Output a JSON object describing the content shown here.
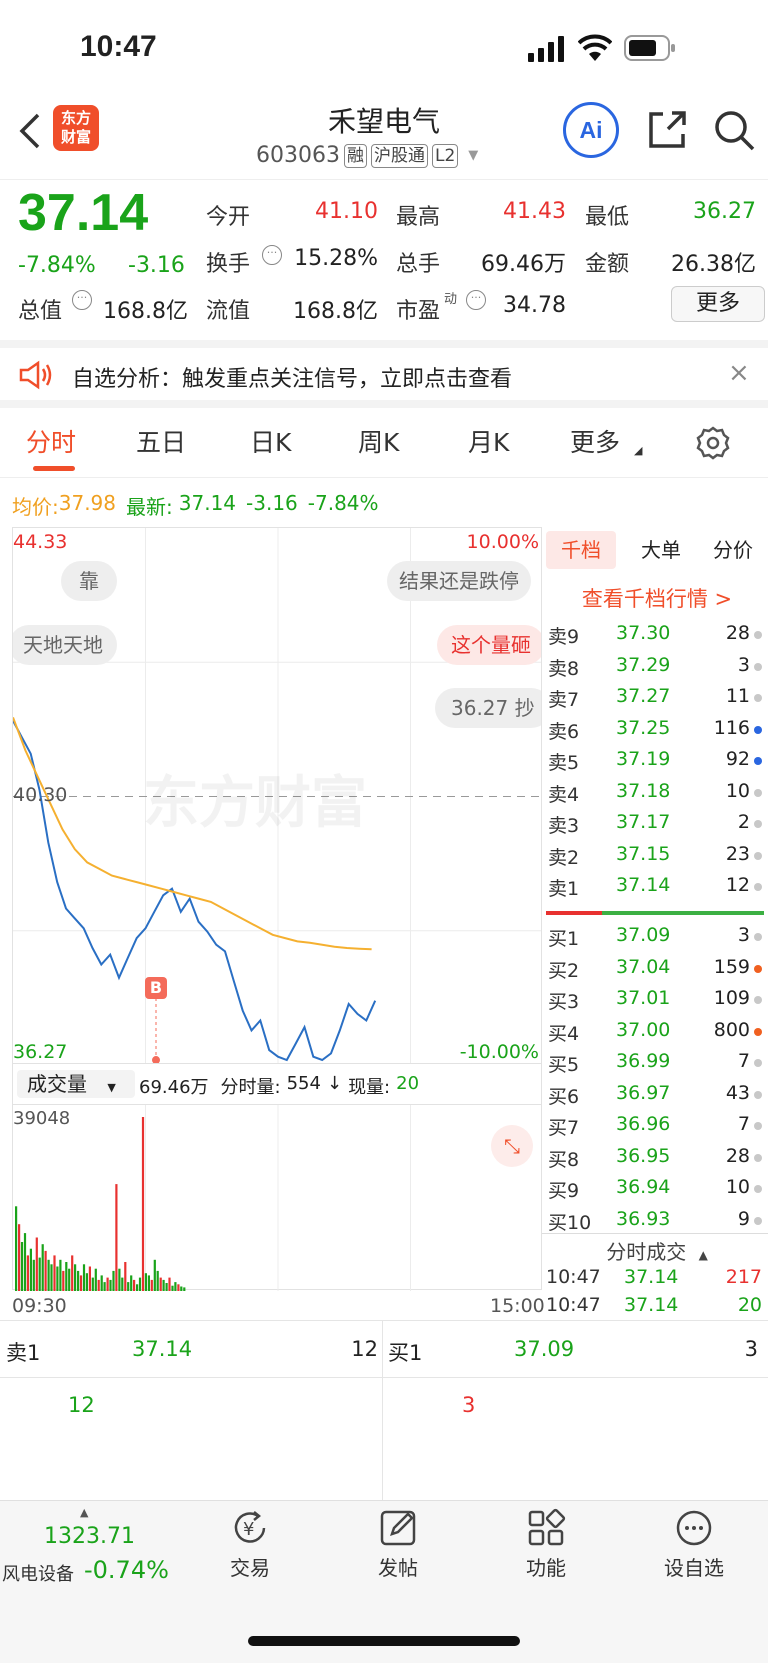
{
  "status_bar": {
    "time": "10:47"
  },
  "header": {
    "logo_line1": "东方",
    "logo_line2": "财富",
    "stock_name": "禾望电气",
    "stock_code": "603063",
    "tags": [
      "融",
      "沪股通",
      "L2"
    ]
  },
  "quote": {
    "price": "37.14",
    "change_pct": "-7.84%",
    "change": "-3.16",
    "fields": [
      {
        "label": "今开",
        "value": "41.10",
        "color": "red"
      },
      {
        "label": "最高",
        "value": "41.43",
        "color": "red"
      },
      {
        "label": "最低",
        "value": "36.27",
        "color": "green"
      },
      {
        "label": "换手",
        "value": "15.28%",
        "color": "dark"
      },
      {
        "label": "总手",
        "value": "69.46万",
        "color": "dark"
      },
      {
        "label": "金额",
        "value": "26.38亿",
        "color": "dark"
      },
      {
        "label": "总值",
        "value": "168.8亿",
        "color": "dark"
      },
      {
        "label": "流值",
        "value": "168.8亿",
        "color": "dark"
      },
      {
        "label": "市盈",
        "value": "34.78",
        "color": "dark"
      }
    ],
    "pe_superscript": "动",
    "more_button": "更多"
  },
  "notice": {
    "text": "自选分析：触发重点关注信号，立即点击查看"
  },
  "tabs": [
    "分时",
    "五日",
    "日K",
    "周K",
    "月K",
    "更多"
  ],
  "chart_header": {
    "avg_label": "均价:",
    "avg_value": "37.98",
    "latest_label": "最新:",
    "latest_value": "37.14",
    "change": "-3.16",
    "change_pct": "-7.84%"
  },
  "bubbles": [
    "靠",
    "天地天地",
    "结果还是跌停",
    "这个量砸",
    "36.27 抄"
  ],
  "watermark": "东方财富",
  "volume_header": {
    "selector": "成交量",
    "total": "69.46万",
    "minute_label": "分时量:",
    "minute_value": "554",
    "arrow": "↓",
    "now_label": "现量:",
    "now_value": "20"
  },
  "chart_data": [
    {
      "type": "line",
      "ylim": [
        36.27,
        44.33
      ],
      "y_tick_labels": [
        "44.33",
        "40.30",
        "36.27"
      ],
      "right_tick_labels": [
        "10.00%",
        "-10.00%"
      ],
      "x_tick_labels": [
        "09:30",
        "15:00"
      ],
      "prev_close": 40.3,
      "series": [
        {
          "values": [
            41.45,
            41.2,
            40.95,
            40.4,
            39.6,
            39.0,
            38.6,
            38.45,
            38.3,
            38.0,
            37.75,
            37.9,
            37.55,
            37.85,
            38.15,
            38.3,
            38.55,
            38.8,
            38.9,
            38.55,
            38.75,
            38.4,
            38.25,
            38.05,
            37.95,
            37.5,
            37.05,
            36.75,
            36.9,
            36.45,
            36.35,
            36.3,
            36.55,
            36.8,
            36.35,
            36.3,
            36.4,
            36.75,
            37.15,
            37.0,
            36.9,
            37.2
          ]
        },
        {
          "values": [
            41.5,
            41.0,
            40.6,
            40.2,
            39.8,
            39.5,
            39.3,
            39.2,
            39.1,
            39.05,
            39.0,
            38.95,
            38.9,
            38.85,
            38.8,
            38.75,
            38.7,
            38.6,
            38.5,
            38.4,
            38.3,
            38.2,
            38.15,
            38.1,
            38.08,
            38.05,
            38.02,
            38.0,
            37.99,
            37.98
          ]
        }
      ],
      "marker": "B"
    },
    {
      "type": "bar",
      "ylim": [
        0,
        39048
      ],
      "y_tick_labels": [
        "39048"
      ],
      "values": [
        19000,
        15000,
        11000,
        13000,
        8000,
        9500,
        7000,
        12000,
        7500,
        10500,
        9000,
        7000,
        6000,
        8000,
        5500,
        7000,
        4500,
        6500,
        5000,
        8000,
        6000,
        4500,
        3500,
        6000,
        4000,
        5500,
        3000,
        5000,
        2500,
        3500,
        2000,
        3000,
        2500,
        4500,
        24000,
        5000,
        3000,
        6500,
        2000,
        3500,
        2500,
        1500,
        3000,
        39048,
        4000,
        3500,
        2500,
        7000,
        4500,
        3000,
        2500,
        1800,
        3000,
        1200,
        2000,
        1500,
        1000,
        800
      ]
    }
  ],
  "order_book": {
    "tabs": [
      "千档",
      "大单",
      "分价"
    ],
    "link": "查看千档行情 >",
    "asks": [
      {
        "label": "卖9",
        "price": "37.30",
        "qty": "28",
        "dot": "gray"
      },
      {
        "label": "卖8",
        "price": "37.29",
        "qty": "3",
        "dot": "gray"
      },
      {
        "label": "卖7",
        "price": "37.27",
        "qty": "11",
        "dot": "gray"
      },
      {
        "label": "卖6",
        "price": "37.25",
        "qty": "116",
        "dot": "blue"
      },
      {
        "label": "卖5",
        "price": "37.19",
        "qty": "92",
        "dot": "blue"
      },
      {
        "label": "卖4",
        "price": "37.18",
        "qty": "10",
        "dot": "gray"
      },
      {
        "label": "卖3",
        "price": "37.17",
        "qty": "2",
        "dot": "gray"
      },
      {
        "label": "卖2",
        "price": "37.15",
        "qty": "23",
        "dot": "gray"
      },
      {
        "label": "卖1",
        "price": "37.14",
        "qty": "12",
        "dot": "gray"
      }
    ],
    "bids": [
      {
        "label": "买1",
        "price": "37.09",
        "qty": "3",
        "dot": "gray"
      },
      {
        "label": "买2",
        "price": "37.04",
        "qty": "159",
        "dot": "orange"
      },
      {
        "label": "买3",
        "price": "37.01",
        "qty": "109",
        "dot": "gray"
      },
      {
        "label": "买4",
        "price": "37.00",
        "qty": "800",
        "dot": "orange"
      },
      {
        "label": "买5",
        "price": "36.99",
        "qty": "7",
        "dot": "gray"
      },
      {
        "label": "买6",
        "price": "36.97",
        "qty": "43",
        "dot": "gray"
      },
      {
        "label": "买7",
        "price": "36.96",
        "qty": "7",
        "dot": "gray"
      },
      {
        "label": "买8",
        "price": "36.95",
        "qty": "28",
        "dot": "gray"
      },
      {
        "label": "买9",
        "price": "36.94",
        "qty": "10",
        "dot": "gray"
      },
      {
        "label": "买10",
        "price": "36.93",
        "qty": "9",
        "dot": "gray"
      }
    ],
    "trades_title": "分时成交",
    "trades": [
      {
        "time": "10:47",
        "price": "37.14",
        "qty": "217",
        "color": "red"
      },
      {
        "time": "10:47",
        "price": "37.14",
        "qty": "20",
        "color": "green"
      }
    ]
  },
  "level1": {
    "sell": {
      "label": "卖1",
      "price": "37.14",
      "qty": "12",
      "sub": "12"
    },
    "buy": {
      "label": "买1",
      "price": "37.09",
      "qty": "3",
      "sub": "3"
    }
  },
  "bottom_nav": {
    "index_value": "1323.71",
    "index_name": "风电设备",
    "index_change": "-0.74%",
    "items": [
      {
        "label": "交易",
        "icon": "trade-icon"
      },
      {
        "label": "发帖",
        "icon": "post-icon"
      },
      {
        "label": "功能",
        "icon": "function-icon"
      },
      {
        "label": "设自选",
        "icon": "add-watchlist-icon"
      }
    ]
  }
}
